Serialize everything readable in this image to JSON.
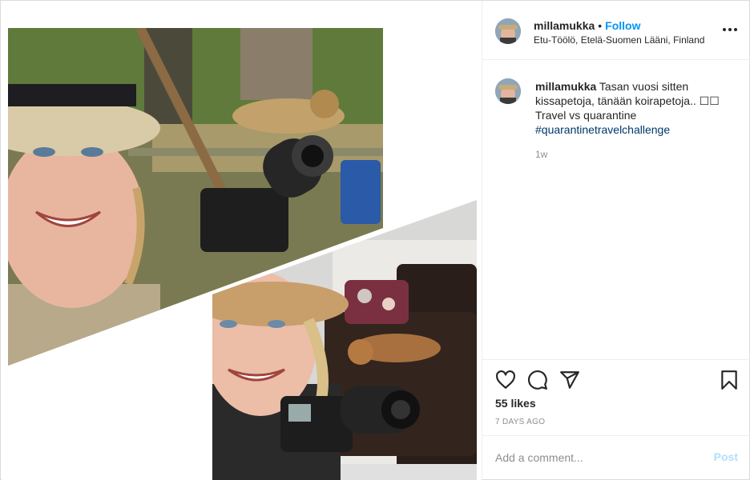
{
  "colors": {
    "accent": "#0095f6",
    "hashtag": "#00376b",
    "muted": "#8e8e8e",
    "post_disabled": "#b2dffc"
  },
  "header": {
    "username": "millamukka",
    "separator": "•",
    "follow_label": "Follow",
    "location": "Etu-Töölö, Etelä-Suomen Lääni, Finland",
    "more_icon": "more-horizontal-icon"
  },
  "caption": {
    "username": "millamukka",
    "text": "Tasan vuosi sitten kissapetoja, tänään koirapetoja.. ☐☐ Travel vs quarantine",
    "hashtag": "#quarantinetravelchallenge",
    "age": "1w"
  },
  "actions": {
    "like_icon": "heart-icon",
    "comment_icon": "comment-icon",
    "share_icon": "paper-plane-icon",
    "save_icon": "bookmark-icon",
    "likes": "55 likes",
    "date": "7 DAYS AGO"
  },
  "comment_box": {
    "placeholder": "Add a comment...",
    "post_label": "Post"
  }
}
